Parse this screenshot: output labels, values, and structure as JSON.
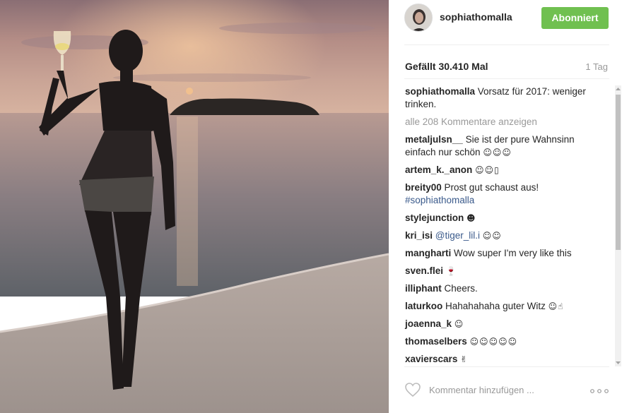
{
  "post": {
    "username": "sophiathomalla",
    "follow_label": "Abonniert",
    "likes": "Gefällt 30.410 Mal",
    "time": "1 Tag",
    "caption": {
      "user": "sophiathomalla",
      "text": "Vorsatz für 2017: weniger trinken."
    },
    "load_more": "alle 208 Kommentare anzeigen",
    "comment_placeholder": "Kommentar hinzufügen ...",
    "follow_color": "#70c050",
    "link_color": "#3a5a8b"
  },
  "comments": [
    {
      "user": "metaljulsn__",
      "text": "Sie ist der pure Wahnsinn einfach nur schön",
      "emoji": "☺☺☺"
    },
    {
      "user": "artem_k._anon",
      "text": "",
      "emoji": "☺☺▯"
    },
    {
      "user": "breity00",
      "text": "Prost gut schaust aus!",
      "hashtag": "#sophiathomalla"
    },
    {
      "user": "stylejunction",
      "text": "",
      "emoji": "☻"
    },
    {
      "user": "kri_isi",
      "mention": "@tiger_lil.i",
      "emoji": "☺☺"
    },
    {
      "user": "mangharti",
      "text": "Wow super I'm very like this"
    },
    {
      "user": "sven.flei",
      "text": "",
      "emoji": "🍷"
    },
    {
      "user": "illiphant",
      "text": "Cheers."
    },
    {
      "user": "laturkoo",
      "text": "Hahahahaha guter Witz",
      "emoji": "☺☝"
    },
    {
      "user": "joaenna_k",
      "text": "",
      "emoji": "☺"
    },
    {
      "user": "thomaselbers",
      "text": "",
      "emoji": "☺☺☺☺☺"
    },
    {
      "user": "xavierscars",
      "text": "",
      "emoji": "✌"
    }
  ],
  "icons": {
    "heart": "heart-outline-icon",
    "more": "more-options-icon",
    "avatar": "profile-avatar"
  }
}
